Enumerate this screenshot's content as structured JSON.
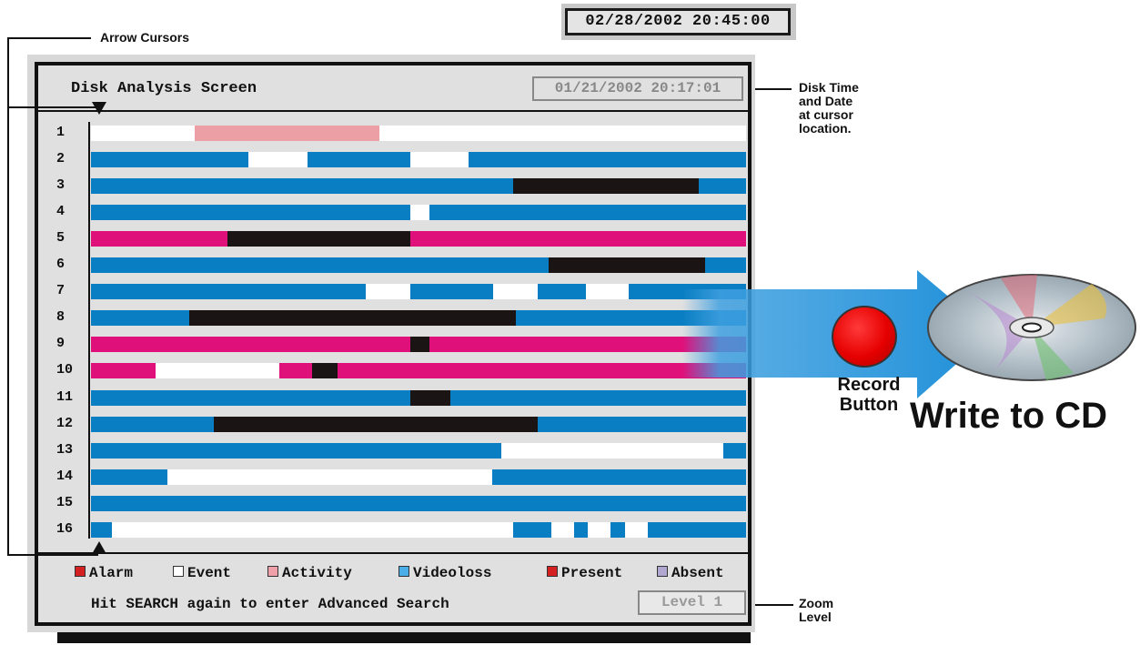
{
  "clock": {
    "value": "02/28/2002 20:45:00"
  },
  "annotations": {
    "arrow_cursors": "Arrow Cursors",
    "disk_time_lines": [
      "Disk Time",
      "and Date",
      "at cursor",
      "location."
    ],
    "zoom_lines": [
      "Zoom",
      "Level"
    ],
    "record_button_lines": [
      "Record",
      "Button"
    ],
    "write_to_cd": "Write to CD"
  },
  "screen": {
    "title": "Disk Analysis Screen",
    "disk_time": "01/21/2002 20:17:01",
    "hint": "Hit SEARCH again to enter Advanced Search",
    "zoom_level": "Level 1"
  },
  "legend": [
    {
      "label": "Alarm",
      "color": "#d42020"
    },
    {
      "label": "Event",
      "color": "#ffffff"
    },
    {
      "label": "Activity",
      "color": "#f0a0a8"
    },
    {
      "label": "Videoloss",
      "color": "#4aaee8"
    },
    {
      "label": "Present",
      "color": "#d42020"
    },
    {
      "label": "Absent",
      "color": "#b0a8d0"
    }
  ],
  "colors": {
    "blue": "#0a7ec2",
    "white": "#ffffff",
    "black": "#1a1414",
    "magenta": "#e0107a",
    "pink": "#eca0a6"
  },
  "channels": [
    {
      "label": "1",
      "segments": [
        [
          "white",
          0,
          0.158
        ],
        [
          "pink",
          0.158,
          0.44
        ],
        [
          "white",
          0.44,
          1
        ]
      ]
    },
    {
      "label": "2",
      "segments": [
        [
          "blue",
          0,
          0.24
        ],
        [
          "white",
          0.24,
          0.33
        ],
        [
          "blue",
          0.33,
          0.487
        ],
        [
          "white",
          0.487,
          0.577
        ],
        [
          "blue",
          0.577,
          1
        ]
      ]
    },
    {
      "label": "3",
      "segments": [
        [
          "blue",
          0,
          0.645
        ],
        [
          "black",
          0.645,
          0.928
        ],
        [
          "blue",
          0.928,
          1
        ]
      ]
    },
    {
      "label": "4",
      "segments": [
        [
          "blue",
          0,
          0.487
        ],
        [
          "white",
          0.487,
          0.516
        ],
        [
          "blue",
          0.516,
          1
        ]
      ]
    },
    {
      "label": "5",
      "segments": [
        [
          "magenta",
          0,
          0.208
        ],
        [
          "black",
          0.208,
          0.487
        ],
        [
          "magenta",
          0.487,
          1
        ]
      ]
    },
    {
      "label": "6",
      "segments": [
        [
          "blue",
          0,
          0.698
        ],
        [
          "black",
          0.698,
          0.938
        ],
        [
          "blue",
          0.938,
          1
        ]
      ]
    },
    {
      "label": "7",
      "segments": [
        [
          "blue",
          0,
          0.42
        ],
        [
          "white",
          0.42,
          0.487
        ],
        [
          "blue",
          0.487,
          0.614
        ],
        [
          "white",
          0.614,
          0.682
        ],
        [
          "blue",
          0.682,
          0.755
        ],
        [
          "white",
          0.755,
          0.821
        ],
        [
          "blue",
          0.821,
          1
        ]
      ]
    },
    {
      "label": "8",
      "segments": [
        [
          "blue",
          0,
          0.15
        ],
        [
          "black",
          0.15,
          0.648
        ],
        [
          "blue",
          0.648,
          1
        ]
      ]
    },
    {
      "label": "9",
      "segments": [
        [
          "magenta",
          0,
          0.487
        ],
        [
          "black",
          0.487,
          0.516
        ],
        [
          "magenta",
          0.516,
          1
        ]
      ]
    },
    {
      "label": "10",
      "segments": [
        [
          "magenta",
          0,
          0.099
        ],
        [
          "white",
          0.099,
          0.287
        ],
        [
          "magenta",
          0.287,
          0.337
        ],
        [
          "black",
          0.337,
          0.377
        ],
        [
          "magenta",
          0.377,
          1
        ]
      ]
    },
    {
      "label": "11",
      "segments": [
        [
          "blue",
          0,
          0.487
        ],
        [
          "black",
          0.487,
          0.549
        ],
        [
          "blue",
          0.549,
          1
        ]
      ]
    },
    {
      "label": "12",
      "segments": [
        [
          "blue",
          0,
          0.187
        ],
        [
          "black",
          0.187,
          0.682
        ],
        [
          "blue",
          0.682,
          1
        ]
      ]
    },
    {
      "label": "13",
      "segments": [
        [
          "blue",
          0,
          0.627
        ],
        [
          "white",
          0.627,
          0.965
        ],
        [
          "blue",
          0.965,
          1
        ]
      ]
    },
    {
      "label": "14",
      "segments": [
        [
          "blue",
          0,
          0.117
        ],
        [
          "white",
          0.117,
          0.612
        ],
        [
          "blue",
          0.612,
          1
        ]
      ]
    },
    {
      "label": "15",
      "segments": [
        [
          "blue",
          0,
          1
        ]
      ]
    },
    {
      "label": "16",
      "segments": [
        [
          "blue",
          0,
          0.032
        ],
        [
          "white",
          0.032,
          0.645
        ],
        [
          "blue",
          0.645,
          0.703
        ],
        [
          "white",
          0.703,
          0.737
        ],
        [
          "blue",
          0.737,
          0.759
        ],
        [
          "white",
          0.759,
          0.793
        ],
        [
          "blue",
          0.793,
          0.815
        ],
        [
          "white",
          0.815,
          0.85
        ],
        [
          "blue",
          0.85,
          1
        ]
      ]
    }
  ]
}
